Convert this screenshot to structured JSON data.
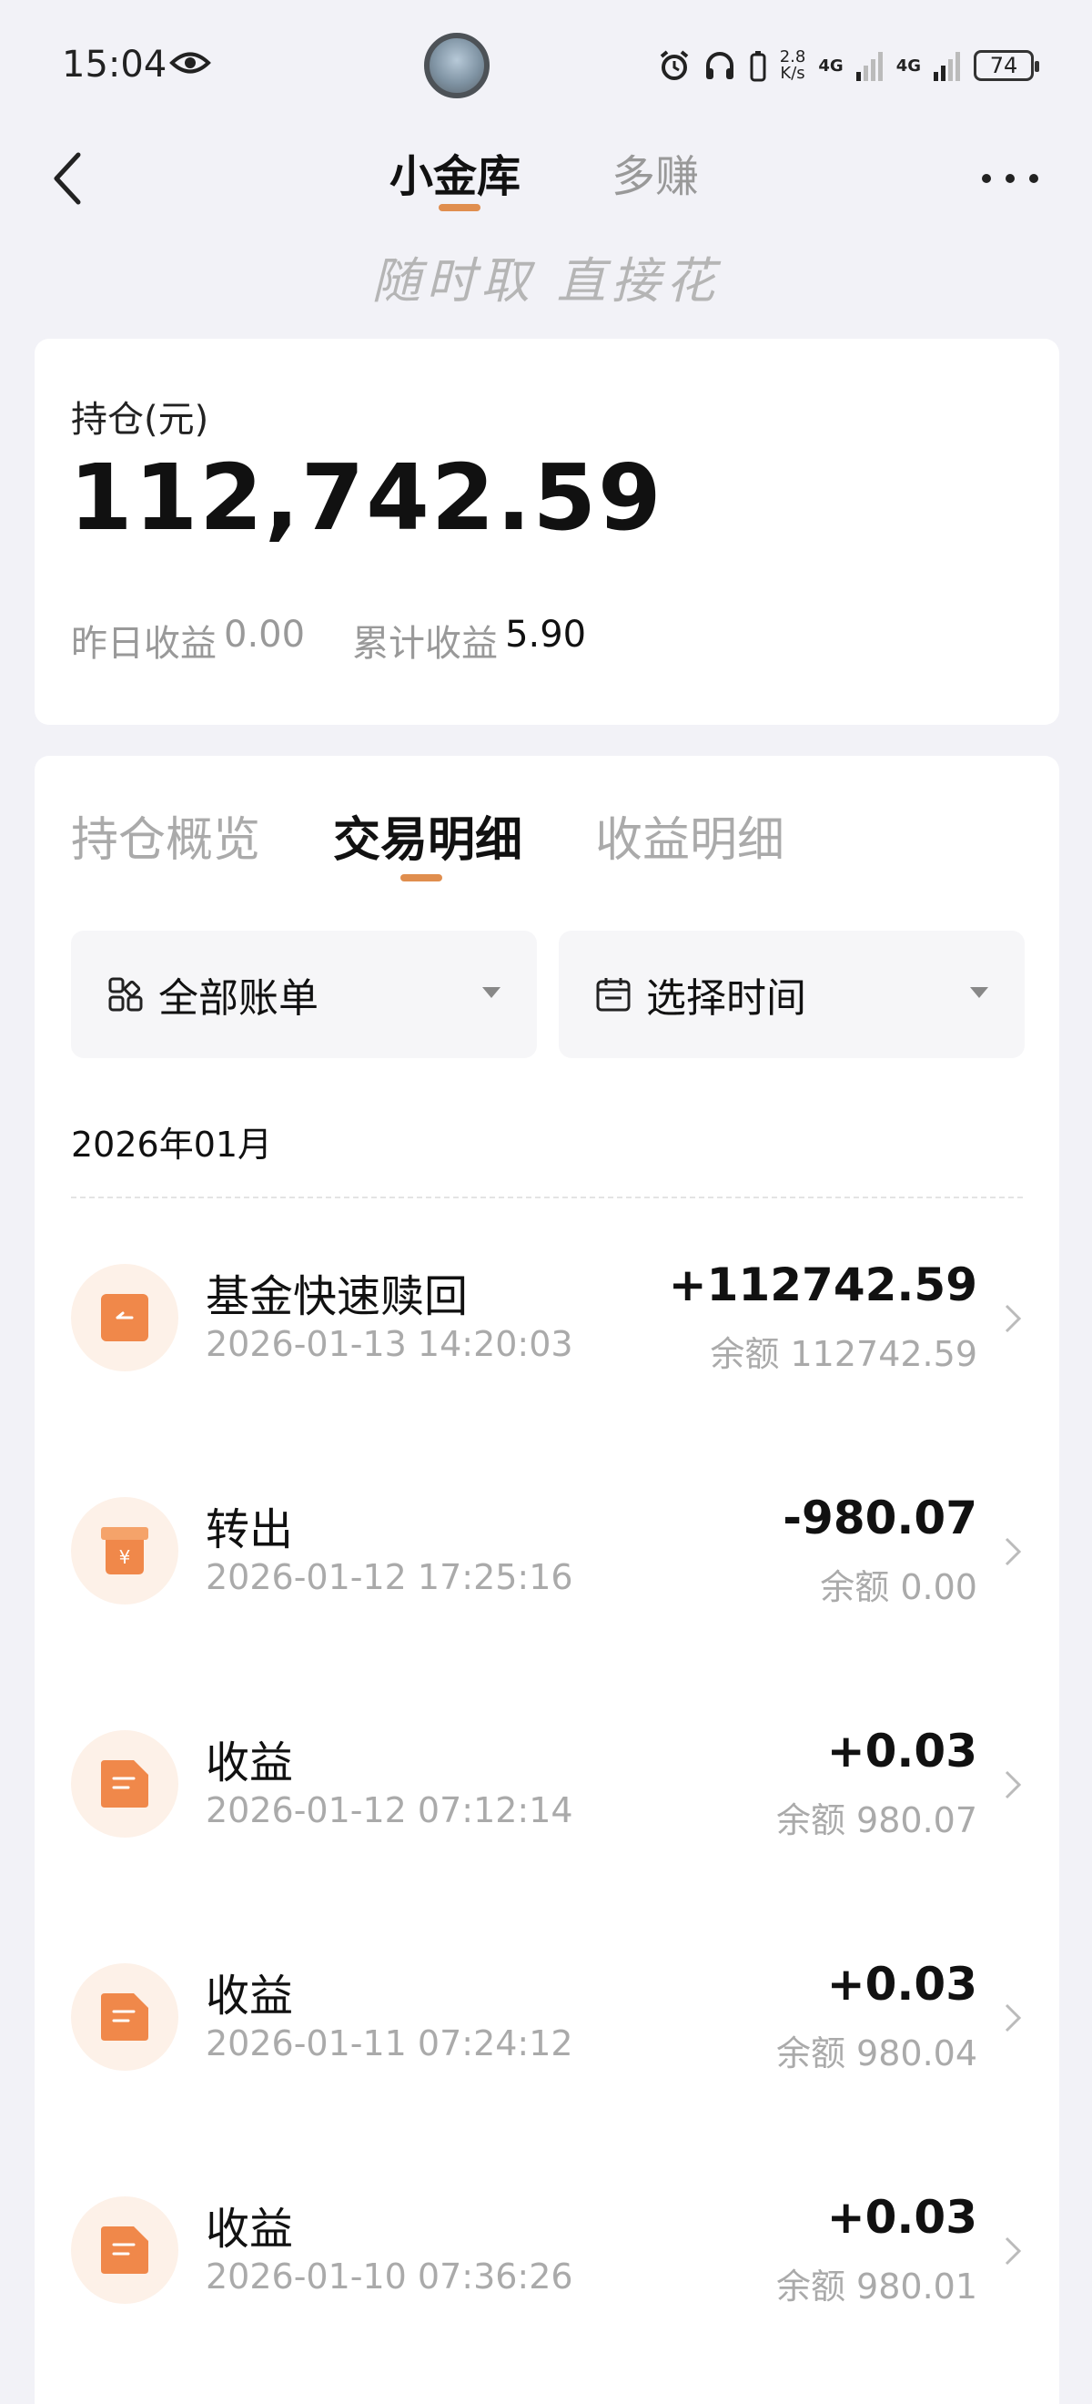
{
  "status_bar": {
    "time": "15:04",
    "net_speed_value": "2.8",
    "net_speed_unit": "K/s",
    "signal1": "4G",
    "signal2": "4G",
    "battery": "74"
  },
  "nav": {
    "tabs": [
      "小金库",
      "多赚"
    ],
    "slogan": "随时取 直接花"
  },
  "holding": {
    "label": "持仓(元)",
    "amount": "112,742.59",
    "yesterday_label": "昨日收益",
    "yesterday_value": "0.00",
    "total_label": "累计收益",
    "total_value": "5.90"
  },
  "detail": {
    "tabs": [
      "持仓概览",
      "交易明细",
      "收益明细"
    ],
    "active_tab": "交易明细",
    "filter_bill": "全部账单",
    "filter_time": "选择时间",
    "month": "2026年01月",
    "transactions": [
      {
        "title": "基金快速赎回",
        "date": "2026-01-13 14:20:03",
        "amount": "+112742.59",
        "balance": "余额 112742.59",
        "icon": "redeem-icon"
      },
      {
        "title": "转出",
        "date": "2026-01-12 17:25:16",
        "amount": "-980.07",
        "balance": "余额 0.00",
        "icon": "transfer-out-icon"
      },
      {
        "title": "收益",
        "date": "2026-01-12 07:12:14",
        "amount": "+0.03",
        "balance": "余额 980.07",
        "icon": "income-icon"
      },
      {
        "title": "收益",
        "date": "2026-01-11 07:24:12",
        "amount": "+0.03",
        "balance": "余额 980.04",
        "icon": "income-icon"
      },
      {
        "title": "收益",
        "date": "2026-01-10 07:36:26",
        "amount": "+0.03",
        "balance": "余额 980.01",
        "icon": "income-icon"
      }
    ]
  },
  "colors": {
    "accent": "#e08e4e",
    "icon_orange": "#f0884a",
    "icon_bg": "#fdf1e8"
  }
}
